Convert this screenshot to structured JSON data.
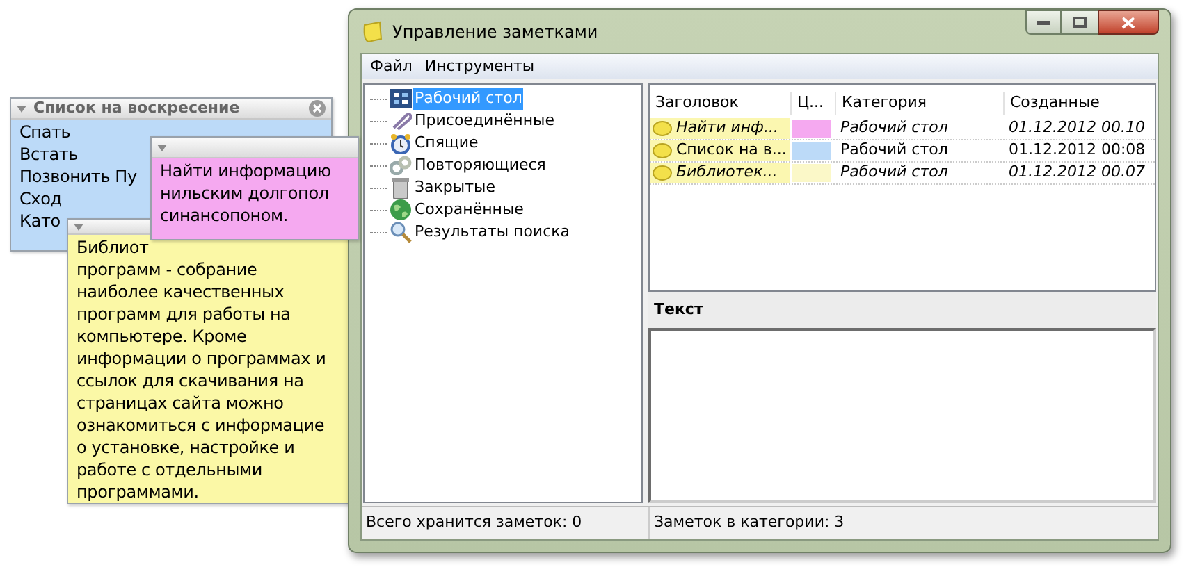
{
  "notes": [
    {
      "kind": "titled",
      "title": "Список на воскресение",
      "color": "#bcdaf8",
      "lines": [
        "Спать",
        "Встать",
        "Позвонить Пу",
        "Сход",
        "Като"
      ]
    },
    {
      "kind": "plain",
      "color": "#f5a9f0",
      "lines": [
        "Найти информацию",
        "нильским долгопол",
        "синансопоном."
      ]
    },
    {
      "kind": "plain",
      "color": "#fbf8a6",
      "lines": [
        "Библиот",
        "программ - собрание",
        "наиболее качественных",
        "программ для работы на",
        "компьютере. Кроме",
        "информации о программах и",
        "ссылок для скачивания на",
        "страницах сайта можно",
        "ознакомиться с информацие",
        "о установке, настройке и",
        "работе с отдельными",
        "программами."
      ]
    }
  ],
  "window": {
    "title": "Управление заметками",
    "menu": [
      "Файл",
      "Инструменты"
    ],
    "tree": [
      {
        "label": "Рабочий стол",
        "selected": true
      },
      {
        "label": "Присоединённые",
        "selected": false
      },
      {
        "label": "Спящие",
        "selected": false
      },
      {
        "label": "Повторяющиеся",
        "selected": false
      },
      {
        "label": "Закрытые",
        "selected": false
      },
      {
        "label": "Сохранённые",
        "selected": false
      },
      {
        "label": "Результаты поиска",
        "selected": false
      }
    ],
    "table": {
      "columns": [
        "Заголовок",
        "Ц...",
        "Категория",
        "Созданные"
      ],
      "rows": [
        {
          "title": "Найти инф...",
          "italic": true,
          "color": "#f5a9f0",
          "category": "Рабочий стол",
          "created": "01.12.2012 00.10"
        },
        {
          "title": "Список на в...",
          "italic": false,
          "color": "#bcdaf8",
          "category": "Рабочий стол",
          "created": "01.12.2012 00:08"
        },
        {
          "title": "Библиотек...",
          "italic": true,
          "color": "#fbf8c8",
          "category": "Рабочий стол",
          "created": "01.12.2012 00.07"
        }
      ]
    },
    "text_header": "Текст",
    "status_bar": [
      "Всего хранится заметок: 0",
      "Заметок в категории: 3"
    ]
  }
}
